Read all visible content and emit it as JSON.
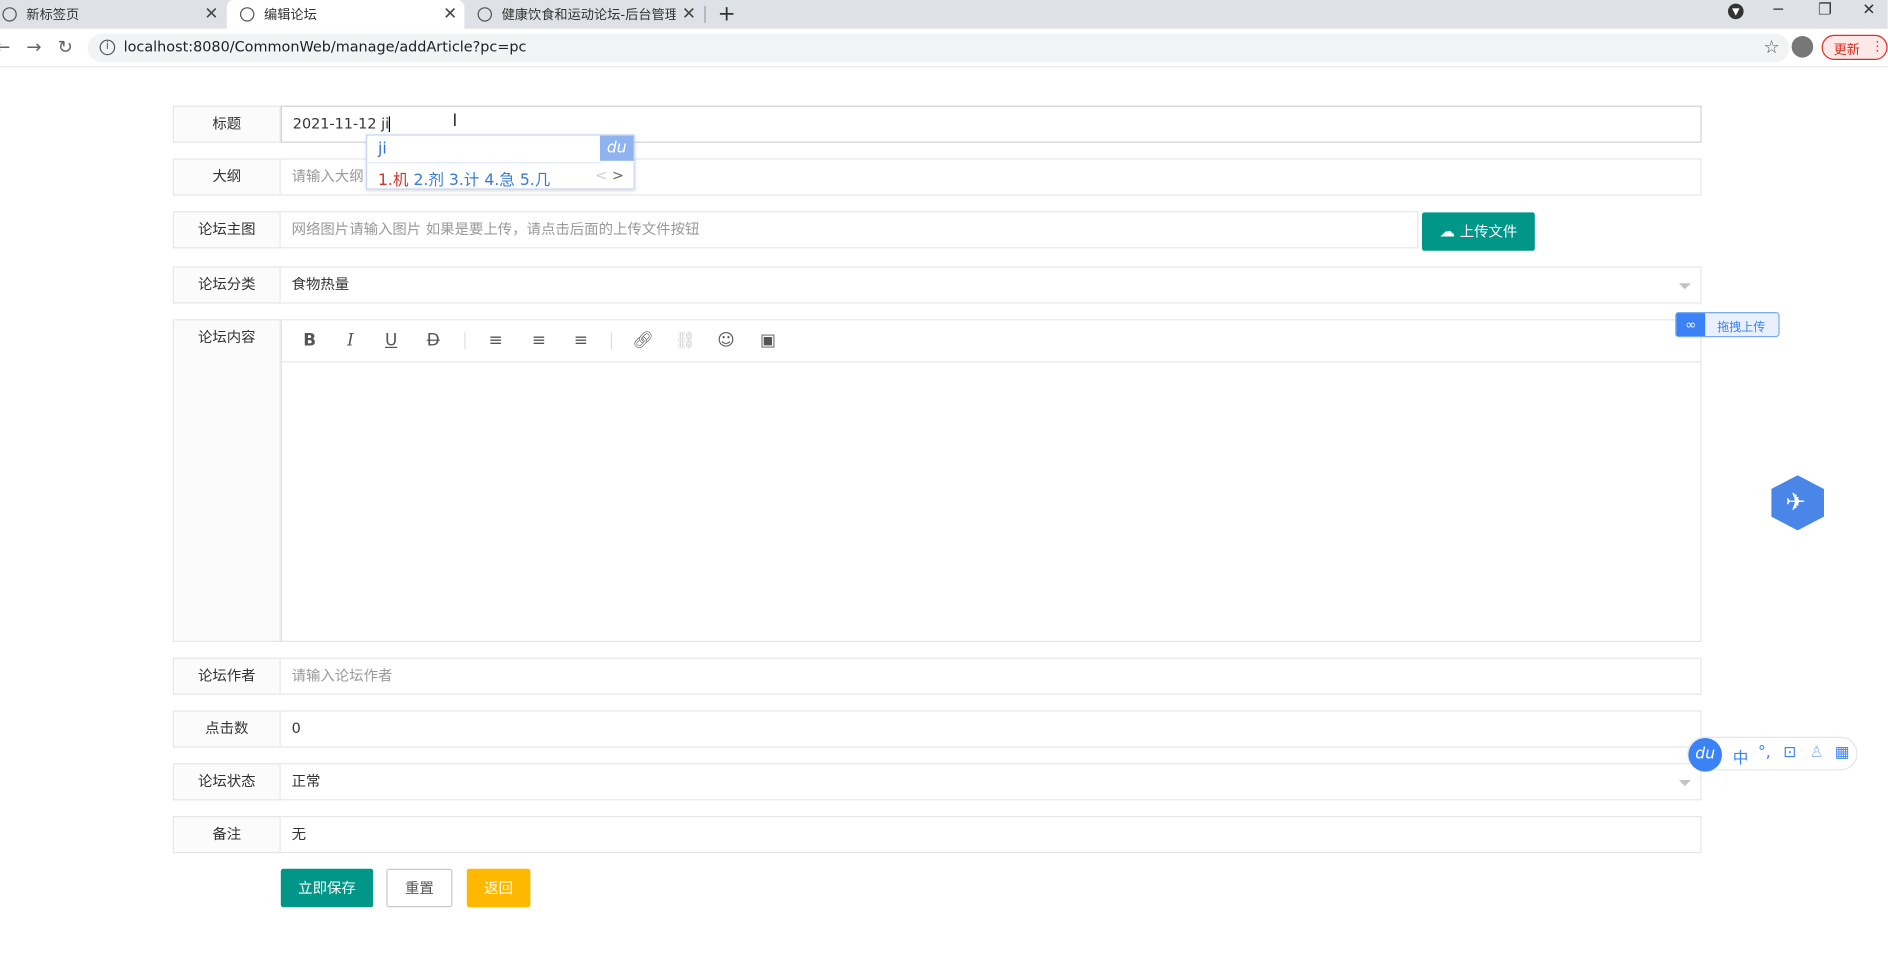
{
  "browser": {
    "tabs": [
      {
        "label": "新标签页"
      },
      {
        "label": "编辑论坛"
      },
      {
        "label": "健康饮食和运动论坛-后台管理系"
      }
    ],
    "url": "localhost:8080/CommonWeb/manage/addArticle?pc=pc",
    "update_label": "更新"
  },
  "form": {
    "title_label": "标题",
    "title_value": "2021-11-12 ji",
    "outline_label": "大纲",
    "outline_placeholder": "请输入大纲",
    "image_label": "论坛主图",
    "image_placeholder": "网络图片请输入图片 如果是要上传，请点击后面的上传文件按钮",
    "upload_label": "上传文件",
    "category_label": "论坛分类",
    "category_value": "食物热量",
    "content_label": "论坛内容",
    "author_label": "论坛作者",
    "author_placeholder": "请输入论坛作者",
    "clicks_label": "点击数",
    "clicks_value": "0",
    "status_label": "论坛状态",
    "status_value": "正常",
    "remark_label": "备注",
    "remark_value": "无",
    "save_label": "立即保存",
    "reset_label": "重置",
    "back_label": "返回"
  },
  "ime": {
    "pinyin": "ji",
    "brand": "du",
    "candidates": [
      "1.机",
      "2.剂",
      "3.计",
      "4.急",
      "5.几"
    ]
  },
  "floating": {
    "drag_upload_label": "拖拽上传",
    "ime_bar_brand": "du",
    "ime_bar_mode": "中"
  },
  "colors": {
    "primary": "#009688",
    "warm": "#ffb800"
  }
}
